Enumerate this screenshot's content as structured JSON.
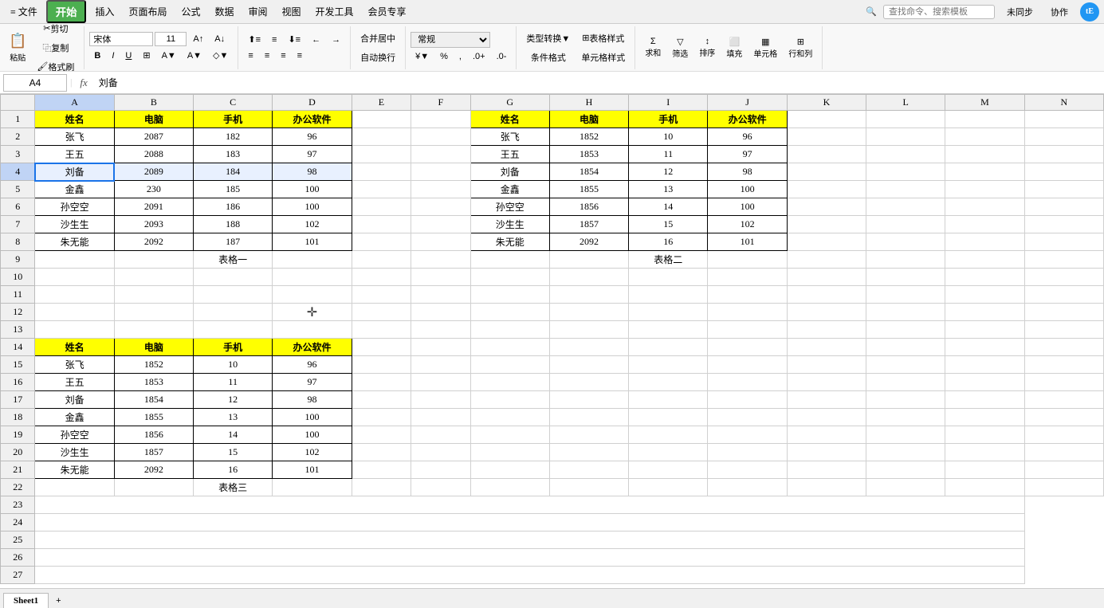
{
  "menubar": {
    "items": [
      "文件",
      "插入",
      "页面布局",
      "公式",
      "数据",
      "审阅",
      "视图",
      "开发工具",
      "会员专享"
    ],
    "start_label": "开始",
    "search_placeholder": "查找命令、搜索模板",
    "sync_label": "未同步",
    "collab_label": "协作",
    "user_label": "tE"
  },
  "toolbar": {
    "paste_label": "粘贴",
    "cut_label": "剪切",
    "copy_label": "复制",
    "format_label": "格式刷",
    "font_name": "宋体",
    "font_size": "11",
    "bold_label": "B",
    "italic_label": "I",
    "underline_label": "U",
    "merge_label": "合并居中",
    "wrap_label": "自动换行",
    "format_dropdown": "常规",
    "table_style_label": "表格样式",
    "cond_format_label": "条件格式",
    "cell_style_label": "单元格样式",
    "sum_label": "求和",
    "filter_label": "筛选",
    "sort_label": "排序",
    "fill_label": "填充",
    "cell_label": "单元格",
    "rowcol_label": "行和列"
  },
  "formula_bar": {
    "cell_ref": "A4",
    "fx_label": "fx",
    "formula_value": "刘备"
  },
  "columns": [
    "",
    "A",
    "B",
    "C",
    "D",
    "E",
    "F",
    "G",
    "H",
    "I",
    "J",
    "K",
    "L",
    "M",
    "N"
  ],
  "table1": {
    "label": "表格一",
    "headers": [
      "姓名",
      "电脑",
      "手机",
      "办公软件"
    ],
    "rows": [
      [
        "张飞",
        "2087",
        "182",
        "96"
      ],
      [
        "王五",
        "2088",
        "183",
        "97"
      ],
      [
        "刘备",
        "2089",
        "184",
        "98"
      ],
      [
        "金鑫",
        "230",
        "185",
        "100"
      ],
      [
        "孙空空",
        "2091",
        "186",
        "100"
      ],
      [
        "沙生生",
        "2093",
        "188",
        "102"
      ],
      [
        "朱无能",
        "2092",
        "187",
        "101"
      ]
    ]
  },
  "table2": {
    "label": "表格二",
    "headers": [
      "姓名",
      "电脑",
      "手机",
      "办公软件"
    ],
    "rows": [
      [
        "张飞",
        "1852",
        "10",
        "96"
      ],
      [
        "王五",
        "1853",
        "11",
        "97"
      ],
      [
        "刘备",
        "1854",
        "12",
        "98"
      ],
      [
        "金鑫",
        "1855",
        "13",
        "100"
      ],
      [
        "孙空空",
        "1856",
        "14",
        "100"
      ],
      [
        "沙生生",
        "1857",
        "15",
        "102"
      ],
      [
        "朱无能",
        "2092",
        "16",
        "101"
      ]
    ]
  },
  "table3": {
    "label": "表格三",
    "headers": [
      "姓名",
      "电脑",
      "手机",
      "办公软件"
    ],
    "rows": [
      [
        "张飞",
        "1852",
        "10",
        "96"
      ],
      [
        "王五",
        "1853",
        "11",
        "97"
      ],
      [
        "刘备",
        "1854",
        "12",
        "98"
      ],
      [
        "金鑫",
        "1855",
        "13",
        "100"
      ],
      [
        "孙空空",
        "1856",
        "14",
        "100"
      ],
      [
        "沙生生",
        "1857",
        "15",
        "102"
      ],
      [
        "朱无能",
        "2092",
        "16",
        "101"
      ]
    ]
  },
  "rows_count": 27,
  "sheet_tab": "Sheet1"
}
